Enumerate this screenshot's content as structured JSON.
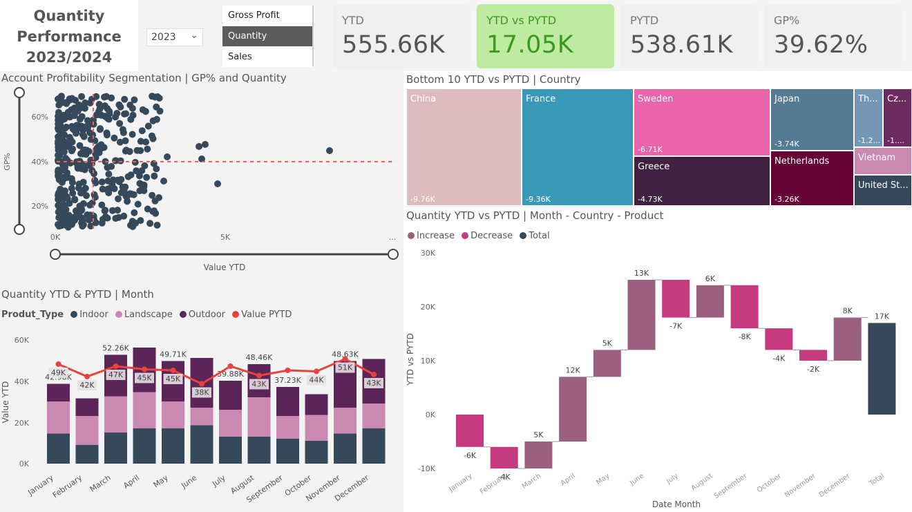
{
  "header": {
    "title_lines": [
      "Quantity",
      "Performance",
      "2023/2024"
    ],
    "year_value": "2023",
    "segments": [
      {
        "label": "Gross Profit",
        "active": false
      },
      {
        "label": "Quantity",
        "active": true
      },
      {
        "label": "Sales",
        "active": false
      }
    ]
  },
  "kpis": [
    {
      "label": "YTD",
      "value": "555.66K",
      "highlight": false
    },
    {
      "label": "YTD vs PYTD",
      "value": "17.05K",
      "highlight": true
    },
    {
      "label": "PYTD",
      "value": "538.61K",
      "highlight": false
    },
    {
      "label": "GP%",
      "value": "39.62%",
      "highlight": false
    }
  ],
  "colors": {
    "navy": "#36495a",
    "pink": "#c989b0",
    "purple": "#5b2557",
    "red": "#e8423c",
    "increase": "#9b5f80",
    "decrease": "#c63a7e",
    "total": "#36495a",
    "kpi_green_bg": "#bfeaa1",
    "kpi_green_text": "#3a9a1c"
  },
  "scatter": {
    "title": "Account Profitability Segmentation | GP% and Quantity",
    "ylabel": "GP%",
    "xlabel": "Value YTD",
    "y_ticks": [
      "60%",
      "40%",
      "20%"
    ],
    "x_ticks": [
      "0K",
      "5K",
      "..."
    ]
  },
  "treemap": {
    "title": "Bottom 10 YTD vs PYTD | Country",
    "items": [
      {
        "name": "China",
        "value": "-9.76K",
        "color": "#ddbbbf"
      },
      {
        "name": "France",
        "value": "-9.36K",
        "color": "#3a98b9"
      },
      {
        "name": "Sweden",
        "value": "-6.71K",
        "color": "#ea64ab"
      },
      {
        "name": "Greece",
        "value": "-4.73K",
        "color": "#40213f"
      },
      {
        "name": "Japan",
        "value": "-3.74K",
        "color": "#557a94"
      },
      {
        "name": "Netherlands",
        "value": "-3.26K",
        "color": "#650436"
      },
      {
        "name": "Th...",
        "value": "-1.2...",
        "color": "#7497b5"
      },
      {
        "name": "Cz...",
        "value": "-1....",
        "color": "#6b2b5f"
      },
      {
        "name": "Vietnam",
        "value": "",
        "color": "#c989b0"
      },
      {
        "name": "United St...",
        "value": "",
        "color": "#36495a"
      }
    ]
  },
  "bar_panel": {
    "title": "Quantity YTD & PYTD | Month",
    "legend_title": "Produt_Type",
    "legend": [
      {
        "name": "Indoor",
        "color": "#36495a"
      },
      {
        "name": "Landscape",
        "color": "#c989b0"
      },
      {
        "name": "Outdoor",
        "color": "#5b2557"
      },
      {
        "name": "Value PYTD",
        "color": "#e8423c"
      }
    ],
    "ylabel": "Value YTD",
    "y_ticks": [
      "60K",
      "40K",
      "20K",
      "0K"
    ]
  },
  "waterfall_panel": {
    "title": "Quantity YTD vs PYTD | Month - Country - Product",
    "legend": [
      {
        "name": "Increase",
        "color": "#9b5f80"
      },
      {
        "name": "Decrease",
        "color": "#c63a7e"
      },
      {
        "name": "Total",
        "color": "#36495a"
      }
    ],
    "ylabel": "YTD vs PYTD",
    "xlabel": "Date Month",
    "y_ticks": [
      "30K",
      "20K",
      "10K",
      "0K",
      "-10K"
    ]
  },
  "chart_data": [
    {
      "type": "bar",
      "title": "Quantity YTD & PYTD | Month",
      "xlabel": "",
      "ylabel": "Value YTD",
      "ylim": [
        0,
        60000
      ],
      "categories": [
        "January",
        "February",
        "March",
        "April",
        "May",
        "June",
        "July",
        "August",
        "September",
        "October",
        "November",
        "December"
      ],
      "series": [
        {
          "name": "Indoor",
          "values": [
            14500,
            9000,
            15000,
            17000,
            17000,
            18500,
            13000,
            13000,
            12000,
            11000,
            14500,
            17000
          ]
        },
        {
          "name": "Landscape",
          "values": [
            15500,
            14000,
            17500,
            17500,
            13000,
            8500,
            13000,
            19000,
            11000,
            12500,
            12500,
            12000
          ]
        },
        {
          "name": "Outdoor",
          "values": [
            8500,
            8500,
            20000,
            21500,
            19500,
            24000,
            14000,
            16000,
            14000,
            10000,
            22500,
            21500
          ]
        },
        {
          "name": "Value PYTD",
          "values": [
            48000,
            42000,
            47000,
            45500,
            45000,
            38500,
            47000,
            42500,
            45000,
            44500,
            50500,
            43000
          ]
        }
      ],
      "top_labels": [
        "42.98K",
        "",
        "52.26K",
        "",
        "49.71K",
        "",
        "39.88K",
        "48.46K",
        "37.23K",
        "",
        "48.63K",
        ""
      ],
      "pytd_labels": [
        "49K",
        "42K",
        "47K",
        "45K",
        "45K",
        "38K",
        "",
        "43K",
        "",
        "44K",
        "51K",
        "43K"
      ]
    },
    {
      "type": "bar",
      "subtype": "waterfall",
      "title": "Quantity YTD vs PYTD | Month - Country - Product",
      "xlabel": "Date Month",
      "ylabel": "YTD vs PYTD",
      "ylim": [
        -10000,
        30000
      ],
      "categories": [
        "January",
        "February",
        "March",
        "April",
        "May",
        "June",
        "July",
        "August",
        "September",
        "October",
        "November",
        "December",
        "Total"
      ],
      "values": [
        -6000,
        -4000,
        5000,
        12000,
        5000,
        13000,
        -7000,
        6000,
        -8000,
        -4000,
        -2000,
        8000,
        17000
      ],
      "labels": [
        "-6K",
        "-4K",
        "5K",
        "12K",
        "5K",
        "13K",
        "-7K",
        "6K",
        "-8K",
        "-4K",
        "-2K",
        "8K",
        "17K"
      ]
    }
  ]
}
